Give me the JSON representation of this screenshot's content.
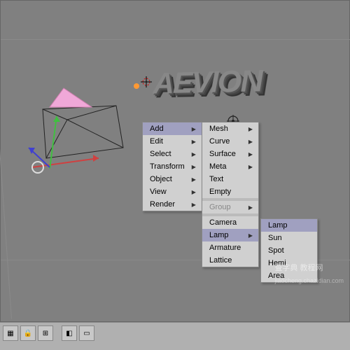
{
  "scene": {
    "text3d": "AEVION"
  },
  "menu1": {
    "items": [
      {
        "label": "Add",
        "arrow": true,
        "hi": true
      },
      {
        "label": "Edit",
        "arrow": true
      },
      {
        "label": "Select",
        "arrow": true
      },
      {
        "label": "Transform",
        "arrow": true
      },
      {
        "label": "Object",
        "arrow": true
      },
      {
        "label": "View",
        "arrow": true
      },
      {
        "label": "Render",
        "arrow": true
      }
    ]
  },
  "menu2": {
    "items": [
      {
        "label": "Mesh",
        "arrow": true
      },
      {
        "label": "Curve",
        "arrow": true
      },
      {
        "label": "Surface",
        "arrow": true
      },
      {
        "label": "Meta",
        "arrow": true
      },
      {
        "label": "Text"
      },
      {
        "label": "Empty"
      },
      {
        "label": ""
      },
      {
        "label": "Group",
        "arrow": true,
        "dis": true
      },
      {
        "label": ""
      },
      {
        "label": "Camera"
      },
      {
        "label": "Lamp",
        "arrow": true,
        "hi": true
      },
      {
        "label": "Armature"
      },
      {
        "label": "Lattice"
      }
    ]
  },
  "menu3": {
    "items": [
      {
        "label": "Lamp",
        "hi": true
      },
      {
        "label": "Sun"
      },
      {
        "label": "Spot"
      },
      {
        "label": "Hemi"
      },
      {
        "label": "Area"
      }
    ]
  },
  "status": {
    "icons": [
      "▦",
      "🔒",
      "⊞",
      "",
      "◧",
      "▭"
    ]
  },
  "watermark": {
    "main": "查字典 教程网",
    "sub": "jiaocheng.chazidian.com"
  },
  "colors": {
    "axis_x": "#d04040",
    "axis_y": "#40c040",
    "axis_z": "#4040d0"
  }
}
